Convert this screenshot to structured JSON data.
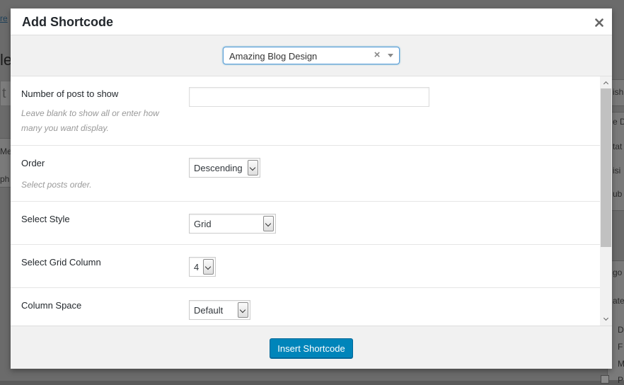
{
  "modal": {
    "title": "Add Shortcode",
    "design_select": {
      "value": "Amazing Blog Design",
      "clear_symbol": "×"
    },
    "fields": {
      "post_count": {
        "label": "Number of post to show",
        "help": "Leave blank to show all or enter how many you want display.",
        "value": ""
      },
      "order": {
        "label": "Order",
        "help": "Select posts order.",
        "value": "Descending"
      },
      "style": {
        "label": "Select Style",
        "value": "Grid"
      },
      "grid_column": {
        "label": "Select Grid Column",
        "value": "4"
      },
      "column_space": {
        "label": "Column Space",
        "value": "Default"
      }
    },
    "insert_label": "Insert Shortcode"
  },
  "background": {
    "link_fragment": "re",
    "heading_fragment": "le",
    "title_fragment": "t",
    "left_fragments": [
      "Me",
      "ph"
    ],
    "right_fragments": [
      "ish",
      "e D",
      "tat",
      "isi",
      "ub",
      "go",
      "ate",
      "D",
      "F",
      "M",
      "P"
    ]
  }
}
